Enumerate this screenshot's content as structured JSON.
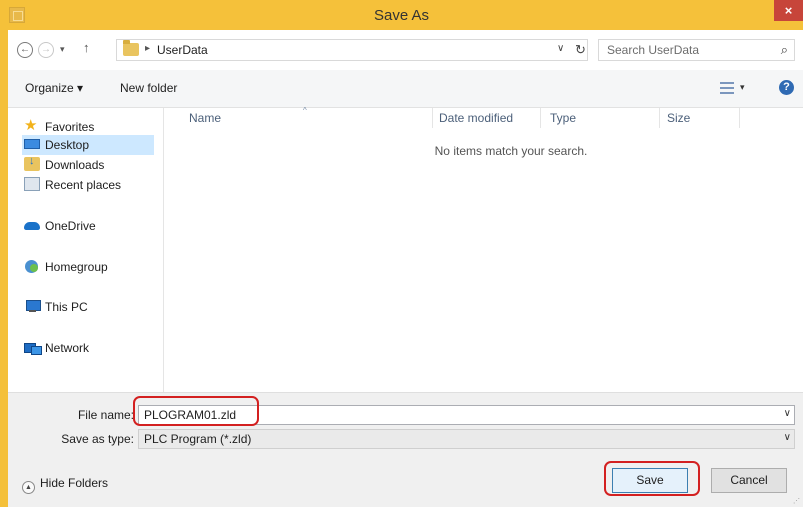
{
  "window": {
    "title": "Save As",
    "close_icon": "×"
  },
  "address": {
    "back_icon": "←",
    "forward_icon": "→",
    "recent_icon": "▾",
    "up_icon": "↑",
    "separator": "▸",
    "path": "UserData",
    "dropdown_icon": "∨",
    "refresh_icon": "↻"
  },
  "search": {
    "placeholder": "Search UserData",
    "icon": "⌕"
  },
  "toolbar": {
    "organize_label": "Organize ▾",
    "new_folder_label": "New folder",
    "view_dropdown": "▾",
    "help_icon": "?"
  },
  "nav": {
    "items": [
      {
        "label": "Favorites",
        "icon": "star-icon"
      },
      {
        "label": "Desktop",
        "icon": "desktop-icon",
        "selected": true
      },
      {
        "label": "Downloads",
        "icon": "downloads-icon"
      },
      {
        "label": "Recent places",
        "icon": "recent-places-icon"
      },
      {
        "label": "OneDrive",
        "icon": "onedrive-icon"
      },
      {
        "label": "Homegroup",
        "icon": "homegroup-icon"
      },
      {
        "label": "This PC",
        "icon": "this-pc-icon"
      },
      {
        "label": "Network",
        "icon": "network-icon"
      }
    ]
  },
  "list": {
    "columns": [
      "Name",
      "Date modified",
      "Type",
      "Size"
    ],
    "sort_indicator": "^",
    "empty_message": "No items match your search."
  },
  "fields": {
    "file_name_label": "File name:",
    "file_name_value": "PLOGRAM01.zld",
    "save_type_label": "Save as type:",
    "save_type_value": "PLC Program (*.zld)",
    "dropdown_icon": "∨"
  },
  "footer": {
    "hide_folders_label": "Hide Folders",
    "hide_folders_icon": "▲",
    "save_label": "Save",
    "cancel_label": "Cancel"
  },
  "colors": {
    "title_bar": "#f5c13a",
    "close_button": "#c7453a",
    "selection": "#cde8ff",
    "annotation_ring": "#d32020"
  }
}
